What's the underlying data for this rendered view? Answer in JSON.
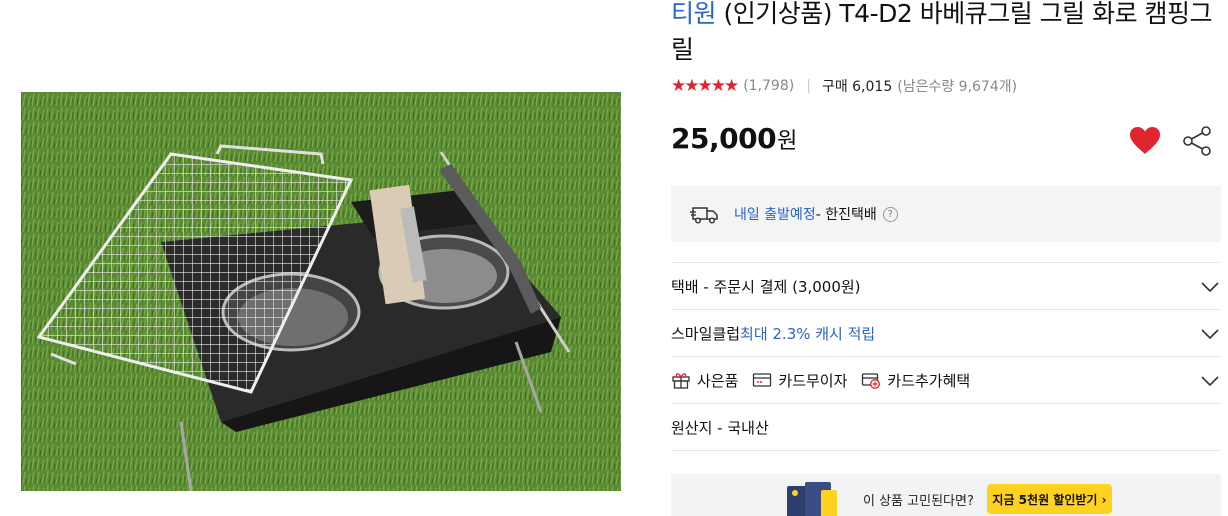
{
  "product": {
    "brand": "티원",
    "title_rest": " (인기상품) T4-D2 바베큐그릴 그릴 화로 캠핑그릴",
    "stars": "★★★★★",
    "review_count": "(1,798)",
    "separator": "|",
    "purchase_count": "구매 6,015",
    "remaining": "(남은수량 9,674개)",
    "price": "25,000",
    "price_unit": "원",
    "rating_color": "#e0252e",
    "brand_color": "#2b64c8"
  },
  "delivery": {
    "schedule": "내일 출발예정",
    "carrier": " - 한진택배",
    "help": "?"
  },
  "options": {
    "shipping": "택배 - 주문시 결제 (3,000원)",
    "smile_prefix": "스마일클럽 ",
    "smile_highlight": "최대 2.3% 캐시 적립",
    "gift": "사은품",
    "card_interest_free": "카드무이자",
    "card_extra_benefit": "카드추가혜택",
    "origin": "원산지 - 국내산"
  },
  "promo": {
    "question": "이 상품 고민된다면?",
    "cta": "지금 5천원 할인받기 ›"
  },
  "icons": {
    "wish": "heart-icon",
    "share": "share-icon",
    "delivery": "truck-icon",
    "chevron": "chevron-down-icon",
    "gift": "gift-icon",
    "card": "card-icon",
    "card_plus": "card-plus-icon"
  }
}
